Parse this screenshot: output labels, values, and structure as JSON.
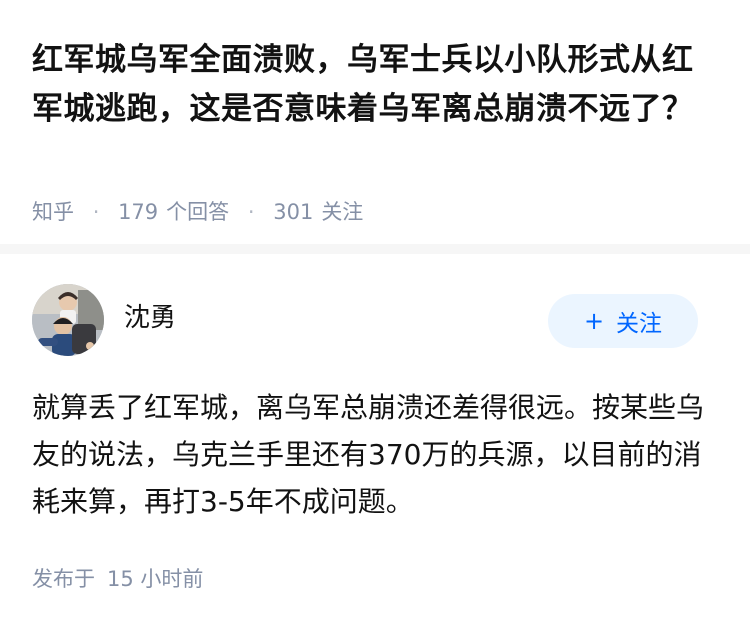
{
  "question": {
    "title": "红军城乌军全面溃败，乌军士兵以小队形式从红军城逃跑，这是否意味着乌军离总崩溃不远了？",
    "source": "知乎",
    "separator": "·",
    "answer_count": "179",
    "answer_label": "个回答",
    "follow_count": "301",
    "follow_label": "关注"
  },
  "answer": {
    "author": "沈勇",
    "follow_button": {
      "icon": "plus-icon",
      "label": "关注"
    },
    "content": "就算丢了红军城，离乌军总崩溃还差得很远。按某些乌友的说法，乌克兰手里还有370万的兵源，以目前的消耗来算，再打3-5年不成问题。",
    "publish_label": "发布于",
    "publish_time": "15 小时前"
  },
  "colors": {
    "title": "#121212",
    "meta": "#8590a6",
    "follow_text": "#0066ff",
    "follow_bg": "#ebf5ff",
    "divider": "#f6f6f6"
  }
}
